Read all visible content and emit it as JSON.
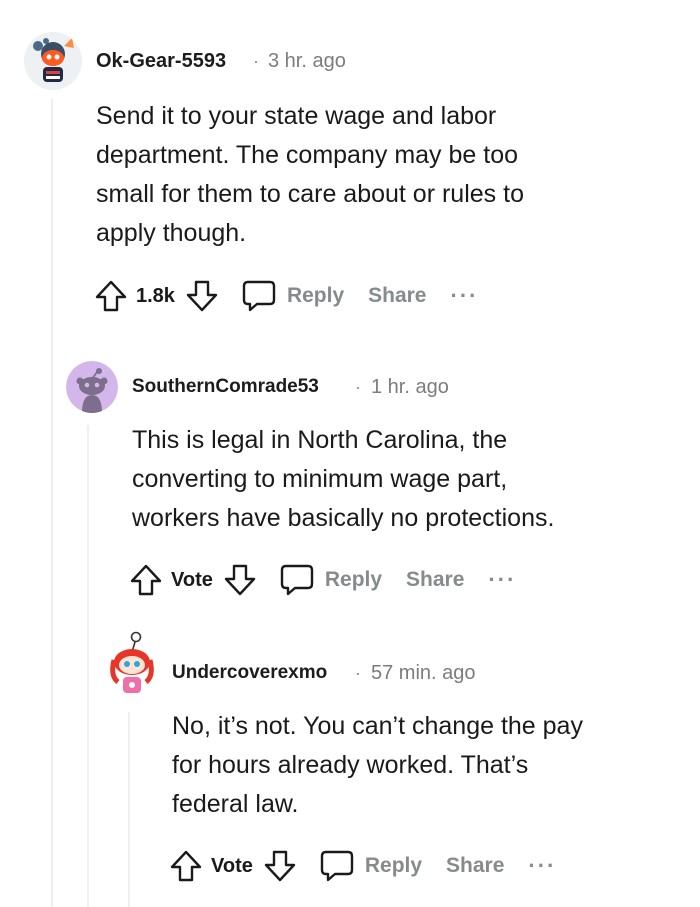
{
  "comments": [
    {
      "username": "Ok-Gear-5593",
      "separator": "·",
      "time": "3 hr. ago",
      "body_lines": [
        "Send it to your state wage and labor",
        "department. The company may be too",
        "small for them to care about or rules to",
        "apply though."
      ],
      "score": "1.8k",
      "reply_label": "Reply",
      "share_label": "Share",
      "more_label": "···",
      "avatar_icon": "snoo-avatar-icon"
    },
    {
      "username": "SouthernComrade53",
      "separator": "·",
      "time": "1 hr. ago",
      "body_lines": [
        "This is legal in North Carolina, the",
        "converting to minimum wage part,",
        "workers have basically no protections."
      ],
      "score": "Vote",
      "reply_label": "Reply",
      "share_label": "Share",
      "more_label": "···",
      "avatar_icon": "default-snoo-icon"
    },
    {
      "username": "Undercoverexmo",
      "separator": "·",
      "time": "57 min. ago",
      "body_lines": [
        "No, it’s not. You can’t change the pay",
        "for hours already worked. That’s",
        "federal law."
      ],
      "score": "Vote",
      "reply_label": "Reply",
      "share_label": "Share",
      "more_label": "···",
      "avatar_icon": "red-hair-snoo-icon"
    }
  ],
  "colors": {
    "text": "#1a1a1b",
    "muted": "#878a8c",
    "thread_line": "#edeff1",
    "avatar2_bg": "#d3b6ea"
  }
}
